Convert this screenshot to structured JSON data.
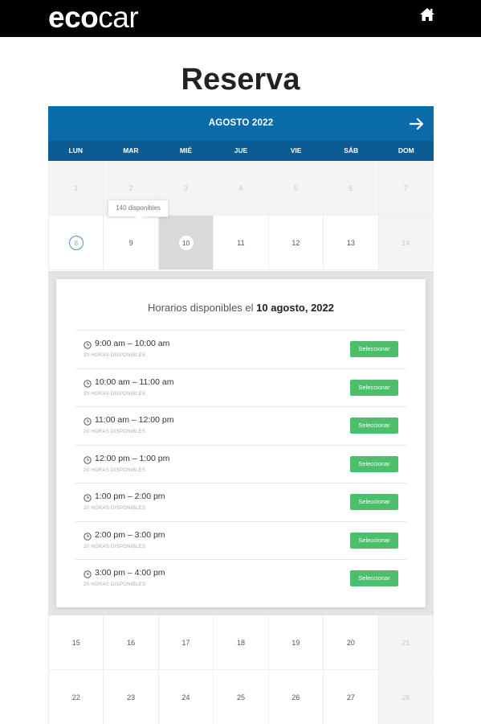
{
  "header": {
    "logo_bold": "eco",
    "logo_light": "car",
    "home_icon": "home-icon"
  },
  "page": {
    "title": "Reserva"
  },
  "calendar": {
    "month": "AGOSTO 2022",
    "next_icon": "arrow-right-icon",
    "weekdays": [
      "LUN",
      "MAR",
      "MIÉ",
      "JUE",
      "VIE",
      "SÁB",
      "DOM"
    ],
    "weeks_top": [
      [
        "1",
        "2",
        "3",
        "4",
        "5",
        "6",
        "7"
      ],
      [
        "8",
        "9",
        "10",
        "11",
        "12",
        "13",
        "14"
      ]
    ],
    "weeks_bottom": [
      [
        "15",
        "16",
        "17",
        "18",
        "19",
        "20",
        "21"
      ],
      [
        "22",
        "23",
        "24",
        "25",
        "26",
        "27",
        "28"
      ]
    ],
    "today": "8",
    "selected": "10",
    "tooltip": "140 disponibles"
  },
  "slots": {
    "title_prefix": "Horarios disponibles el",
    "title_date": "10 agosto, 2022",
    "button_label": "Seleccionar",
    "items": [
      {
        "time": "9:00 am – 10:00 am",
        "avail": "20 HORAS DISPONIBLES"
      },
      {
        "time": "10:00 am – 11:00 am",
        "avail": "20 HORAS DISPONIBLES"
      },
      {
        "time": "11:00 am – 12:00 pm",
        "avail": "20 HORAS DISPONIBLES"
      },
      {
        "time": "12:00 pm – 1:00 pm",
        "avail": "20 HORAS DISPONIBLES"
      },
      {
        "time": "1:00 pm – 2:00 pm",
        "avail": "20 HORAS DISPONIBLES"
      },
      {
        "time": "2:00 pm – 3:00 pm",
        "avail": "20 HORAS DISPONIBLES"
      },
      {
        "time": "3:00 pm – 4:00 pm",
        "avail": "20 HORAS DISPONIBLES"
      }
    ]
  },
  "colors": {
    "header_bg": "#000000",
    "calendar_primary": "#0a6bab",
    "calendar_dow": "#0c5c92",
    "button": "#4cbe6c"
  }
}
